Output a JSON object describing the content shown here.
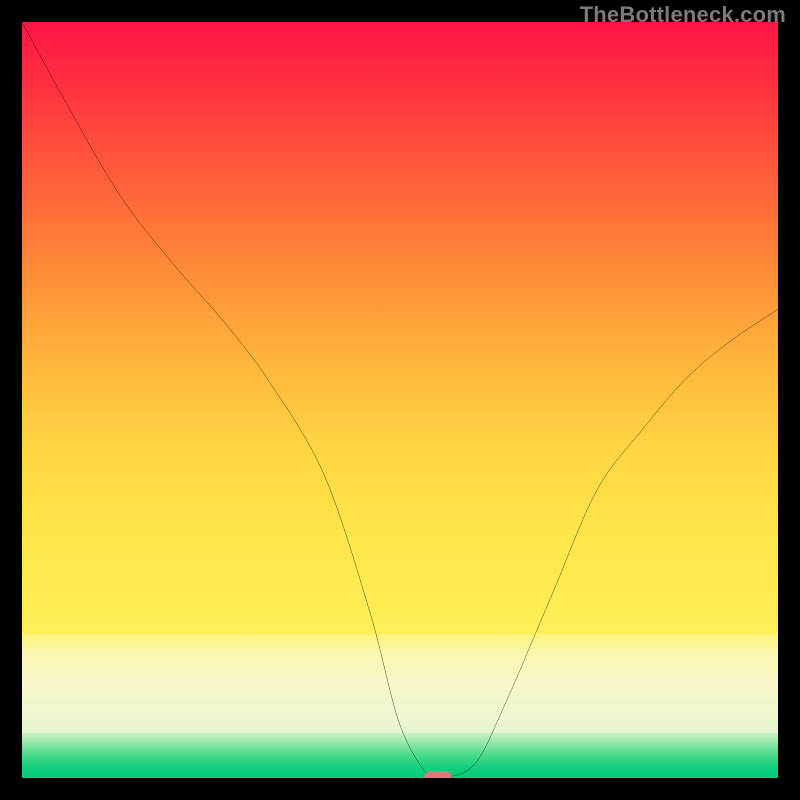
{
  "watermark": "TheBottleneck.com",
  "chart_data": {
    "type": "line",
    "title": "",
    "xlabel": "",
    "ylabel": "",
    "xlim": [
      0,
      100
    ],
    "ylim": [
      0,
      100
    ],
    "grid": false,
    "legend": false,
    "curve_color": "#000000",
    "curve": {
      "x": [
        0,
        6,
        13,
        20,
        27,
        33,
        40,
        46,
        50,
        54,
        56,
        60,
        64,
        70,
        76,
        82,
        88,
        94,
        100
      ],
      "y": [
        100,
        89,
        77,
        68,
        60,
        52,
        40,
        22,
        7,
        0,
        0,
        2,
        10,
        24,
        38,
        46,
        53,
        58,
        62
      ]
    },
    "min_point": {
      "x": 55,
      "y": 0
    },
    "gradient_bands": [
      {
        "name": "red-yellow",
        "from_pct": 0,
        "to_pct": 81
      },
      {
        "name": "cream",
        "from_pct": 81,
        "to_pct": 94
      },
      {
        "name": "green",
        "from_pct": 94,
        "to_pct": 100
      }
    ],
    "colors": {
      "top": "#ff1445",
      "mid": "#ffd642",
      "cream": "#f8f7c8",
      "green": "#03cc78",
      "marker": "#d97a7d"
    }
  }
}
